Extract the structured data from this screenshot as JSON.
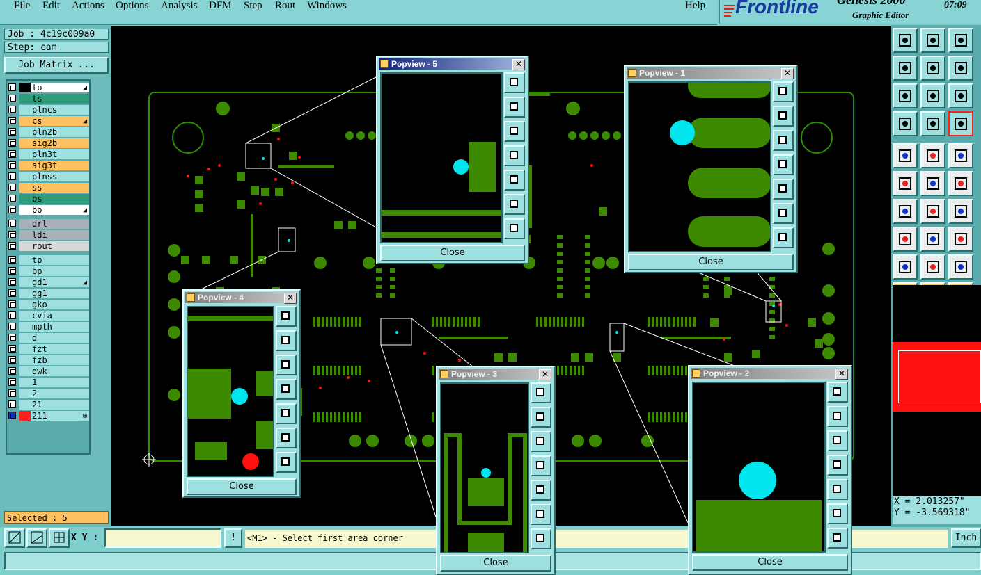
{
  "menu": [
    "File",
    "Edit",
    "Actions",
    "Options",
    "Analysis",
    "DFM",
    "Step",
    "Rout",
    "Windows",
    "Help"
  ],
  "brand": {
    "logo": "Frontline",
    "product": "Genesis 2000",
    "subtitle": "Graphic Editor",
    "time": "07:09"
  },
  "job": {
    "job_label": "Job : 4c19c009a0",
    "step_label": "Step: cam",
    "matrix_button": "Job Matrix ..."
  },
  "layers": [
    {
      "name": "to",
      "color": "#ffffff",
      "swatch": "#000000",
      "mark": "◢"
    },
    {
      "name": "ts",
      "color": "#2e9b7d",
      "swatch": "#2e9b7d",
      "mark": ""
    },
    {
      "name": "plncs",
      "color": "#9ee0e0",
      "swatch": "#9ee0e0",
      "mark": ""
    },
    {
      "name": "cs",
      "color": "#ffc060",
      "swatch": "#ffc060",
      "mark": "◢"
    },
    {
      "name": "pln2b",
      "color": "#9ee0e0",
      "swatch": "#9ee0e0",
      "mark": ""
    },
    {
      "name": "sig2b",
      "color": "#ffc060",
      "swatch": "#ffc060",
      "mark": ""
    },
    {
      "name": "pln3t",
      "color": "#9ee0e0",
      "swatch": "#9ee0e0",
      "mark": ""
    },
    {
      "name": "sig3t",
      "color": "#ffc060",
      "swatch": "#ffc060",
      "mark": ""
    },
    {
      "name": "plnss",
      "color": "#9ee0e0",
      "swatch": "#9ee0e0",
      "mark": ""
    },
    {
      "name": "ss",
      "color": "#ffc060",
      "swatch": "#ffc060",
      "mark": ""
    },
    {
      "name": "bs",
      "color": "#2e9b7d",
      "swatch": "#2e9b7d",
      "mark": ""
    },
    {
      "name": "bo",
      "color": "#ffffff",
      "swatch": "#ffffff",
      "mark": "◢"
    },
    {
      "name": "drl",
      "color": "#a8b0b8",
      "swatch": "#a8b0b8",
      "mark": ""
    },
    {
      "name": "ldi",
      "color": "#a8b0b8",
      "swatch": "#a8b0b8",
      "mark": ""
    },
    {
      "name": "rout",
      "color": "#d8d8d8",
      "swatch": "#d8d8d8",
      "mark": ""
    },
    {
      "name": "tp",
      "color": "#9ee0e0",
      "swatch": "#9ee0e0",
      "mark": ""
    },
    {
      "name": "bp",
      "color": "#9ee0e0",
      "swatch": "#9ee0e0",
      "mark": ""
    },
    {
      "name": "gd1",
      "color": "#9ee0e0",
      "swatch": "#9ee0e0",
      "mark": "◢"
    },
    {
      "name": "gg1",
      "color": "#9ee0e0",
      "swatch": "#9ee0e0",
      "mark": ""
    },
    {
      "name": "gko",
      "color": "#9ee0e0",
      "swatch": "#9ee0e0",
      "mark": ""
    },
    {
      "name": "cvia",
      "color": "#9ee0e0",
      "swatch": "#9ee0e0",
      "mark": ""
    },
    {
      "name": "mpth",
      "color": "#9ee0e0",
      "swatch": "#9ee0e0",
      "mark": ""
    },
    {
      "name": "d",
      "color": "#9ee0e0",
      "swatch": "#9ee0e0",
      "mark": ""
    },
    {
      "name": "fzt",
      "color": "#9ee0e0",
      "swatch": "#9ee0e0",
      "mark": ""
    },
    {
      "name": "fzb",
      "color": "#9ee0e0",
      "swatch": "#9ee0e0",
      "mark": ""
    },
    {
      "name": "dwk",
      "color": "#9ee0e0",
      "swatch": "#9ee0e0",
      "mark": ""
    },
    {
      "name": "1",
      "color": "#9ee0e0",
      "swatch": "#9ee0e0",
      "mark": ""
    },
    {
      "name": "2",
      "color": "#9ee0e0",
      "swatch": "#9ee0e0",
      "mark": ""
    },
    {
      "name": "21",
      "color": "#9ee0e0",
      "swatch": "#9ee0e0",
      "mark": ""
    },
    {
      "name": "211",
      "color": "#9ee0e0",
      "swatch": "#ff2020",
      "mark": "⊞"
    }
  ],
  "selected_label": "Selected : 5",
  "xy_label": "X Y :",
  "xy_value": "",
  "prompt_text": "<M1> - Select first area corner",
  "units_button": "Inch",
  "coords": {
    "x": "X = 2.013257\"",
    "y": "Y = -3.569318\""
  },
  "popups": [
    {
      "title": "Popview - 5",
      "close": "Close"
    },
    {
      "title": "Popview - 1",
      "close": "Close"
    },
    {
      "title": "Popview - 4",
      "close": "Close"
    },
    {
      "title": "Popview - 3",
      "close": "Close"
    },
    {
      "title": "Popview - 2",
      "close": "Close"
    }
  ],
  "colors": {
    "copper": "#3d8a00",
    "outline": "#2a8a00",
    "highlight": "#00e5ee",
    "drill": "#ff1010",
    "canvas": "#000000"
  }
}
